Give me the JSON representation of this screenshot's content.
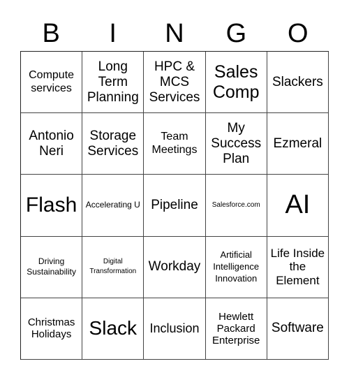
{
  "header": {
    "letters": [
      "B",
      "I",
      "N",
      "G",
      "O"
    ]
  },
  "cells": [
    [
      "Compute services",
      "Long Term Planning",
      "HPC & MCS Services",
      "Sales Comp",
      "Slackers"
    ],
    [
      "Antonio Neri",
      "Storage Services",
      "Team Meetings",
      "My Success Plan",
      "Ezmeral"
    ],
    [
      "Flash",
      "Accelerating U",
      "Pipeline",
      "Salesforce.com",
      "AI"
    ],
    [
      "Driving Sustainability",
      "Digital Transformation",
      "Workday",
      "Artificial Intelligence Innovation",
      "Life Inside the Element"
    ],
    [
      "Christmas Holidays",
      "Slack",
      "Inclusion",
      "Hewlett Packard Enterprise",
      "Software"
    ]
  ]
}
